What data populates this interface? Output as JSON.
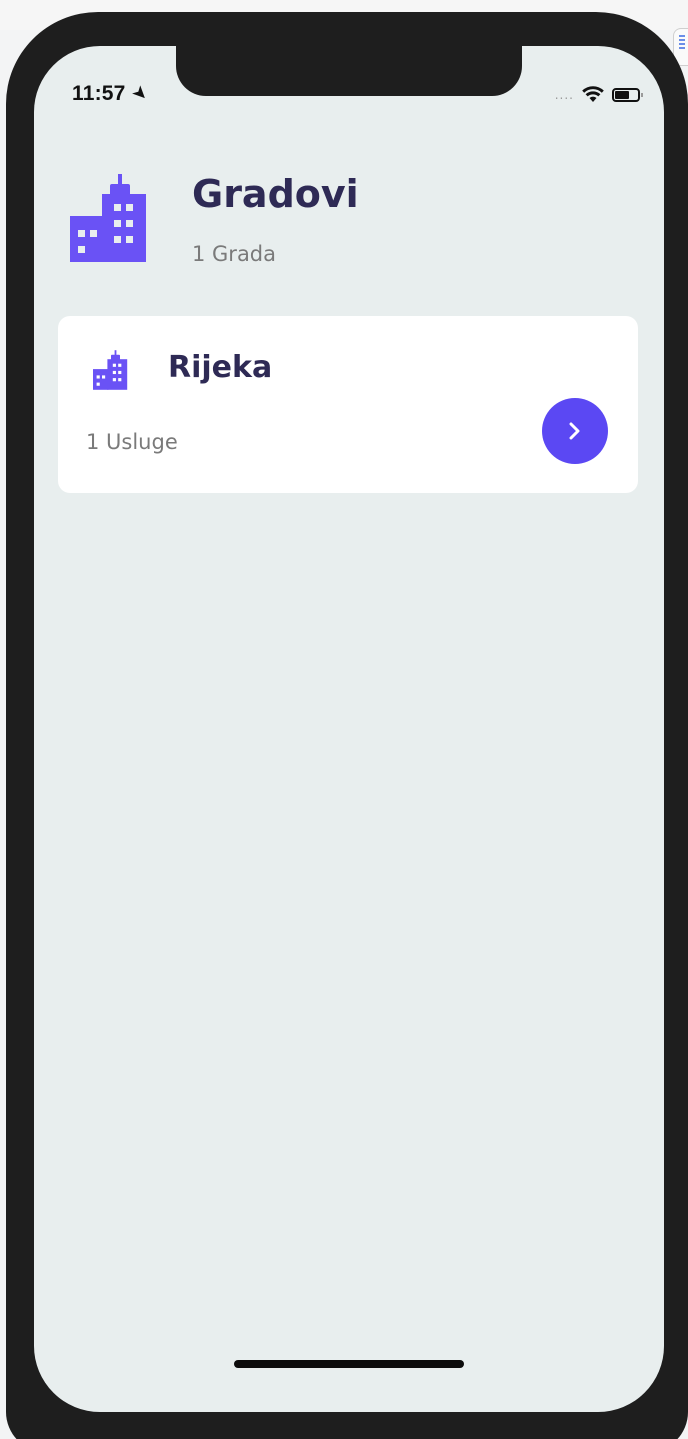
{
  "status_bar": {
    "time": "11:57",
    "signal_dots": "....",
    "location_icon": "location-arrow-icon",
    "wifi_icon": "wifi-icon",
    "battery_icon": "battery-icon"
  },
  "header": {
    "icon": "building-icon",
    "title": "Gradovi",
    "subtitle": "1 Grada"
  },
  "cities": [
    {
      "icon": "building-icon",
      "name": "Rijeka",
      "services": "1 Usluge",
      "action_icon": "chevron-right-icon"
    }
  ],
  "colors": {
    "accent": "#5b48f3",
    "title": "#2e2a55",
    "muted": "#7a7a7a",
    "screen_bg": "#e8eeee",
    "card_bg": "#ffffff"
  }
}
